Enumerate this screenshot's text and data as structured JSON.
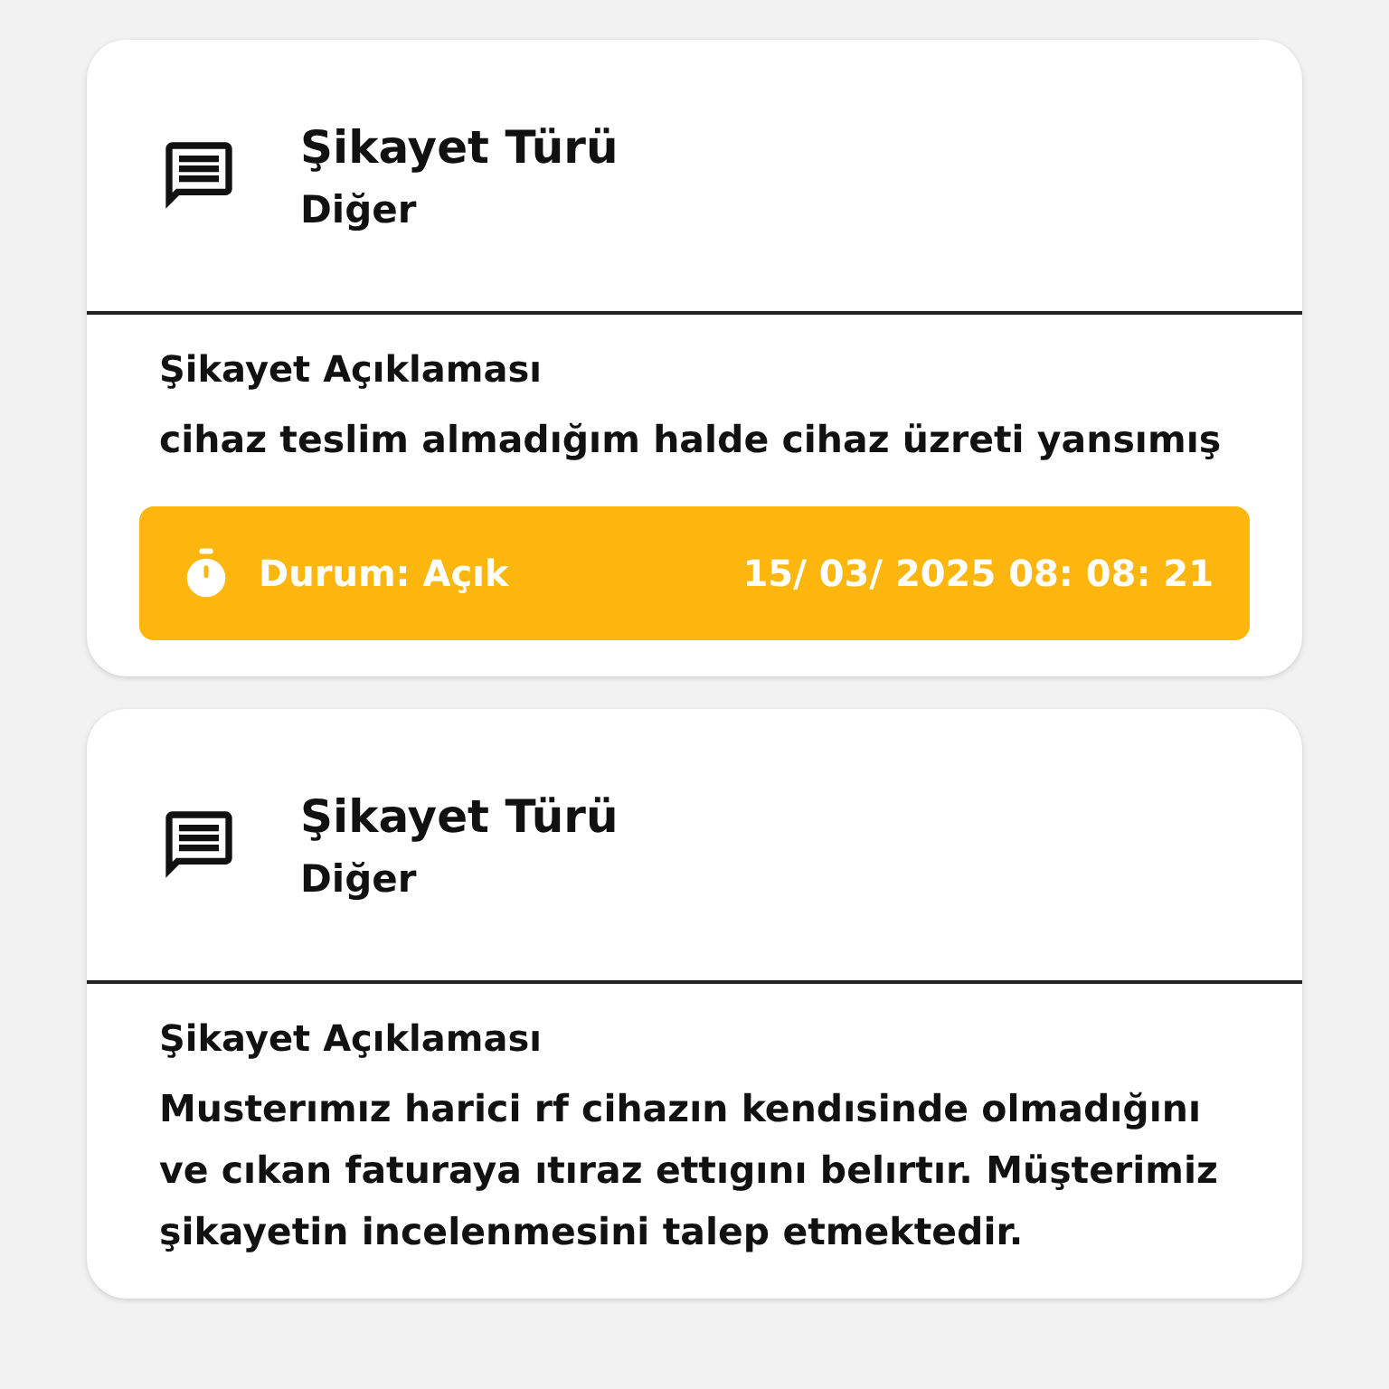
{
  "complaints": [
    {
      "type_label": "Şikayet Türü",
      "type_value": "Diğer",
      "description_label": "Şikayet Açıklaması",
      "description": "cihaz teslim almadığım halde cihaz üzreti yansımış",
      "status": {
        "label": "Durum: Açık",
        "date": "15/ 03/ 2025 08: 08: 21",
        "color": "#fdb60d"
      }
    },
    {
      "type_label": "Şikayet Türü",
      "type_value": "Diğer",
      "description_label": "Şikayet Açıklaması",
      "description": "Musterımız harici rf cihazın kendısinde olmadığını ve cıkan faturaya ıtıraz ettıgını belırtır. Müşterimiz şikayetin incelenmesini talep etmektedir."
    }
  ]
}
